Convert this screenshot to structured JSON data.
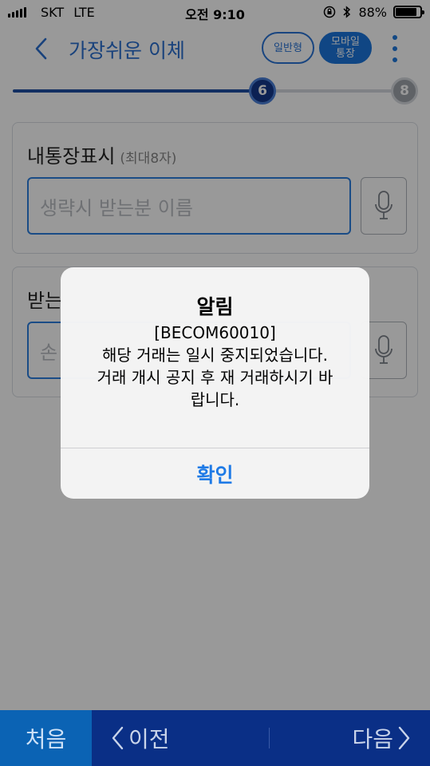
{
  "status_bar": {
    "carrier": "SKT",
    "network": "LTE",
    "time": "오전 9:10",
    "battery_percent": "88%",
    "battery_level": 0.88
  },
  "header": {
    "title": "가장쉬운 이체",
    "general_label": "일반형",
    "mobile_label_line1": "모바일",
    "mobile_label_line2": "통장",
    "accent_color": "#2a6fcf"
  },
  "progress": {
    "current_step": "6",
    "total_steps": "8",
    "fraction": 0.62
  },
  "memo_field": {
    "label": "내통장표시",
    "hint": "(최대8자)",
    "placeholder": "생략시 받는분 이름"
  },
  "recipient_field": {
    "label": "받는",
    "placeholder": "손"
  },
  "alert": {
    "title": "알림",
    "code": "[BECOM60010]",
    "line1": "해당 거래는 일시 중지되었습니다.",
    "line2": "거래 개시 공지 후 재 거래하시기 바",
    "line3": "랍니다.",
    "ok_label": "확인"
  },
  "bottom_bar": {
    "first_label": "처음",
    "prev_label": "이전",
    "next_label": "다음"
  }
}
